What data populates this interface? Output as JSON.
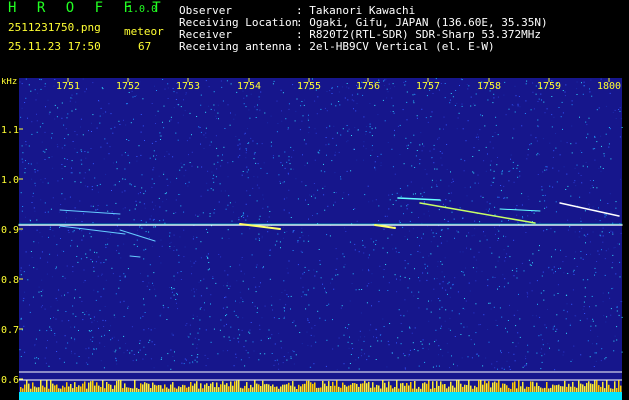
{
  "app": {
    "logo": "H R O F F T",
    "version": "1.0.0",
    "filename": "2511231750.png",
    "datetime": "25.11.23 17:50",
    "detection_label": "meteor",
    "detection_count": "67"
  },
  "info": {
    "labels": [
      "Observer",
      "Receiving Location",
      "Receiver",
      "Receiving antenna"
    ],
    "values": [
      ": Takanori Kawachi",
      ": Ogaki, Gifu, JAPAN (136.60E, 35.35N)",
      ": R820T2(RTL-SDR) SDR-Sharp 53.372MHz",
      ": 2el-HB9CV Vertical (el. E-W)"
    ]
  },
  "spectrogram": {
    "y_unit": "kHz",
    "y_ticks": [
      "1.1",
      "1.0",
      "0.9",
      "0.8",
      "0.7",
      "0.6"
    ],
    "x_ticks": [
      "1751",
      "1752",
      "1753",
      "1754",
      "1755",
      "1756",
      "1757",
      "1758",
      "1759",
      "1800"
    ],
    "colors": {
      "background": "#16168c",
      "text": "#ffff33",
      "carrier": "#ffffff",
      "strip": "#00e5ff"
    }
  }
}
